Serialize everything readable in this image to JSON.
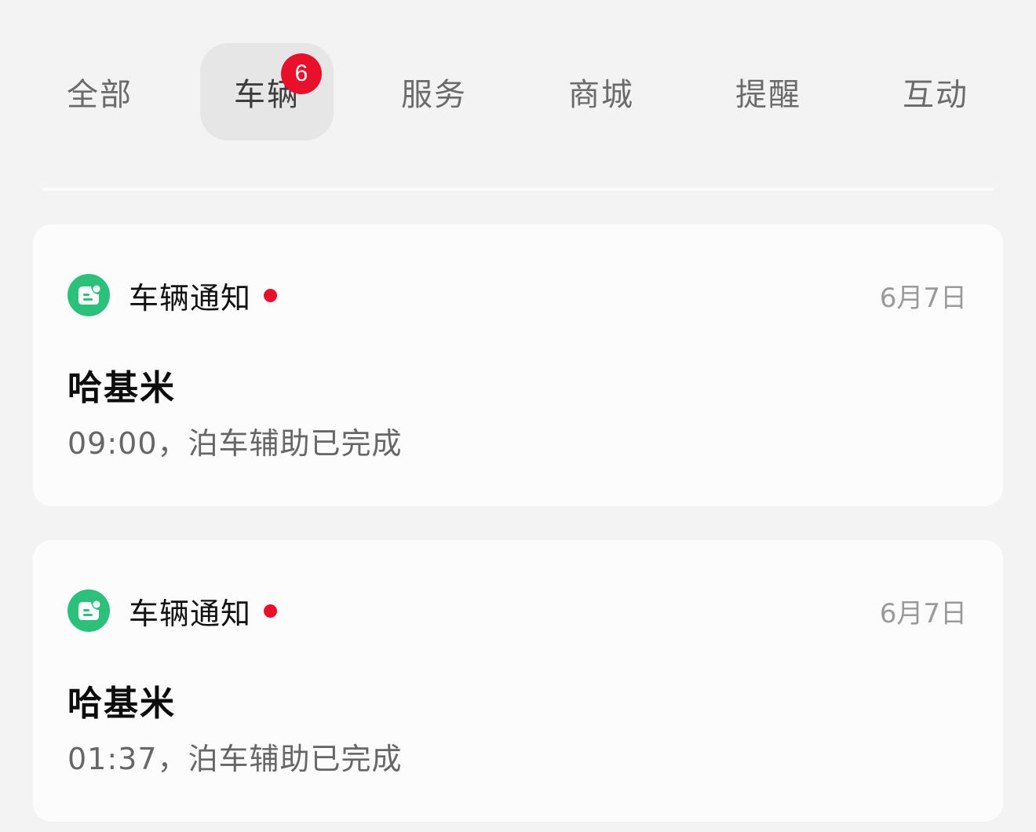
{
  "tabs": [
    {
      "label": "全部"
    },
    {
      "label": "车辆",
      "badge": "6",
      "active": true
    },
    {
      "label": "服务"
    },
    {
      "label": "商城"
    },
    {
      "label": "提醒"
    },
    {
      "label": "互动"
    }
  ],
  "colors": {
    "background": "#f3f3f3",
    "card": "#fcfcfc",
    "badge": "#e8102a",
    "icon_green": "#2bc17b",
    "date_gray": "#9a9a9a",
    "message_gray": "#666666"
  },
  "notifications": [
    {
      "icon": "robot-face-icon",
      "title": "车辆通知",
      "unread": true,
      "date": "6月7日",
      "name": "哈基米",
      "message": "09:00，泊车辅助已完成"
    },
    {
      "icon": "robot-face-icon",
      "title": "车辆通知",
      "unread": true,
      "date": "6月7日",
      "name": "哈基米",
      "message": "01:37，泊车辅助已完成"
    }
  ]
}
